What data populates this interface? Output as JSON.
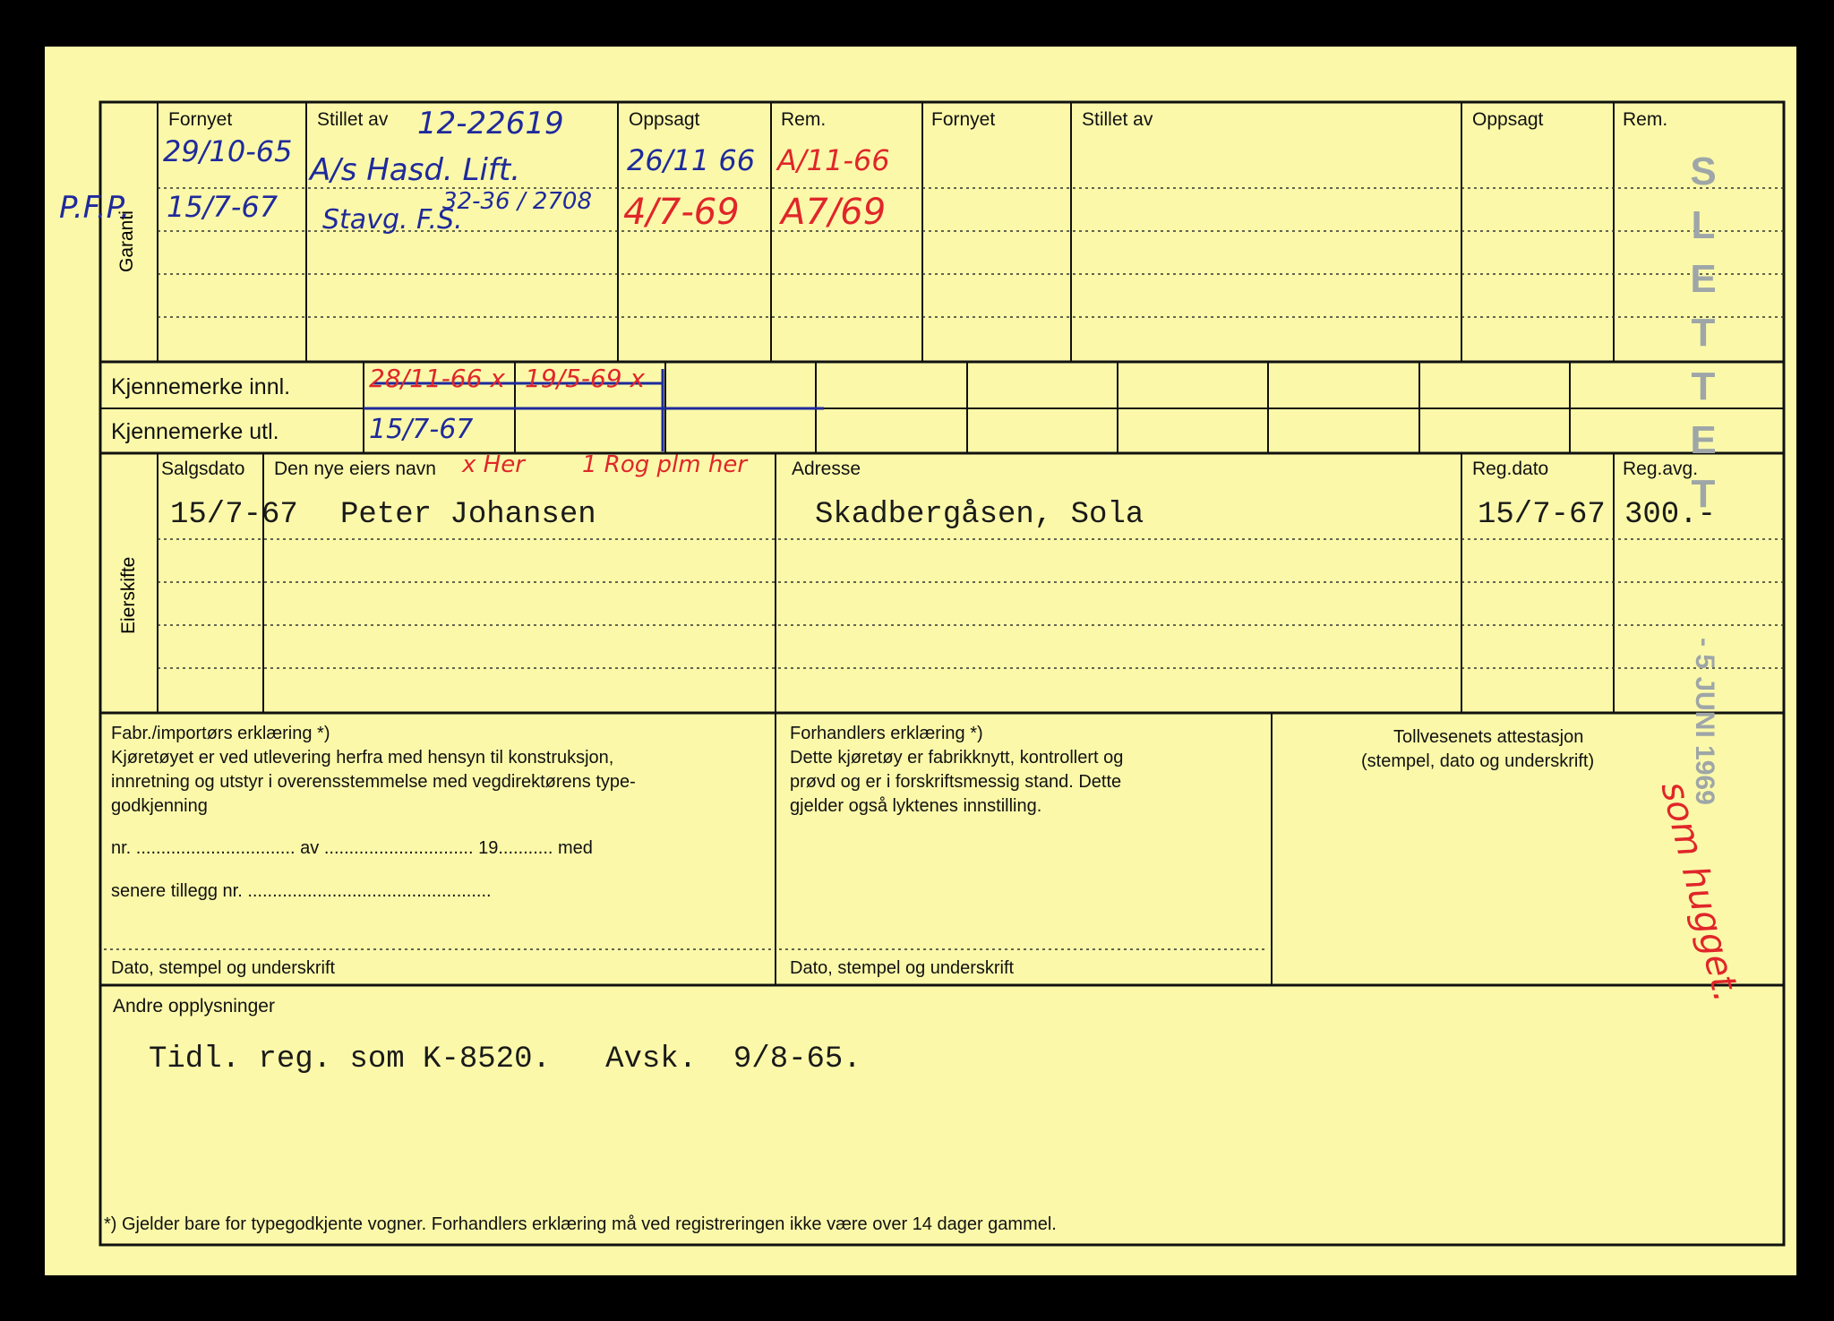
{
  "garanti": {
    "section_label": "Garanti",
    "headers": [
      "Fornyet",
      "Stillet av",
      "Oppsagt",
      "Rem.",
      "Fornyet",
      "Stillet av",
      "Oppsagt",
      "Rem."
    ],
    "margin_note": "P.F.P.",
    "entries": {
      "fornyet_1": "29/10-65",
      "fornyet_2": "15/7-67",
      "stillet_av_top": "12-22619",
      "stillet_av_1": "A/s Hasd. Lift.",
      "stillet_av_2": "32-36 / 2708",
      "stillet_av_3": "Stavg. F.S.",
      "oppsagt_1": "26/11 66",
      "oppsagt_2": "4/7-69",
      "rem_1": "A/11-66",
      "rem_2": "A7/69"
    }
  },
  "kjennemerke": {
    "innl_label": "Kjennemerke innl.",
    "utl_label": "Kjennemerke utl.",
    "innl_1": "28/11-66 x",
    "innl_2": "19/5-69 x",
    "utl_1": "15/7-67"
  },
  "eierskifte": {
    "section_label": "Eierskifte",
    "headers": {
      "salgsdato": "Salgsdato",
      "navn": "Den nye eiers navn",
      "adresse": "Adresse",
      "regdato": "Reg.dato",
      "regavg": "Reg.avg."
    },
    "handwritten_note_1": "x Her",
    "handwritten_note_2": "1 Rog plm her",
    "rows": [
      {
        "salgsdato": "15/7-67",
        "navn": "Peter Johansen",
        "adresse": "Skadbergåsen, Sola",
        "regdato": "15/7-67",
        "regavg": "300.-"
      }
    ]
  },
  "erklaering": {
    "fabr_title": "Fabr./importørs erklæring *)",
    "fabr_lines": [
      "Kjøretøyet er ved utlevering herfra med hensyn til konstruksjon,",
      "innretning og utstyr i overensstemmelse med vegdirektørens type-",
      "godkjenning"
    ],
    "fabr_line_nr": "nr. ................................ av .............................. 19........... med",
    "fabr_line_tillegg": "senere tillegg nr. .................................................",
    "fabr_footer": "Dato, stempel og underskrift",
    "forh_title": "Forhandlers erklæring *)",
    "forh_lines": [
      "Dette kjøretøy er fabrikknytt, kontrollert og",
      "prøvd og er i forskriftsmessig stand. Dette",
      "gjelder også lyktenes innstilling."
    ],
    "forh_footer": "Dato, stempel og underskrift",
    "toll_title": "Tollvesenets attestasjon",
    "toll_sub": "(stempel, dato og underskrift)"
  },
  "andre": {
    "label": "Andre opplysninger",
    "text": "Tidl. reg. som K-8520.   Avsk.  9/8-65."
  },
  "stamps": {
    "slettet": "SLETTET",
    "date": "- 5 JUNI 1969"
  },
  "red_vertical_note": "som hugget.",
  "footnote": "*)  Gjelder bare for typegodkjente vogner.  Forhandlers erklæring må ved registreringen ikke være over 14 dager gammel."
}
